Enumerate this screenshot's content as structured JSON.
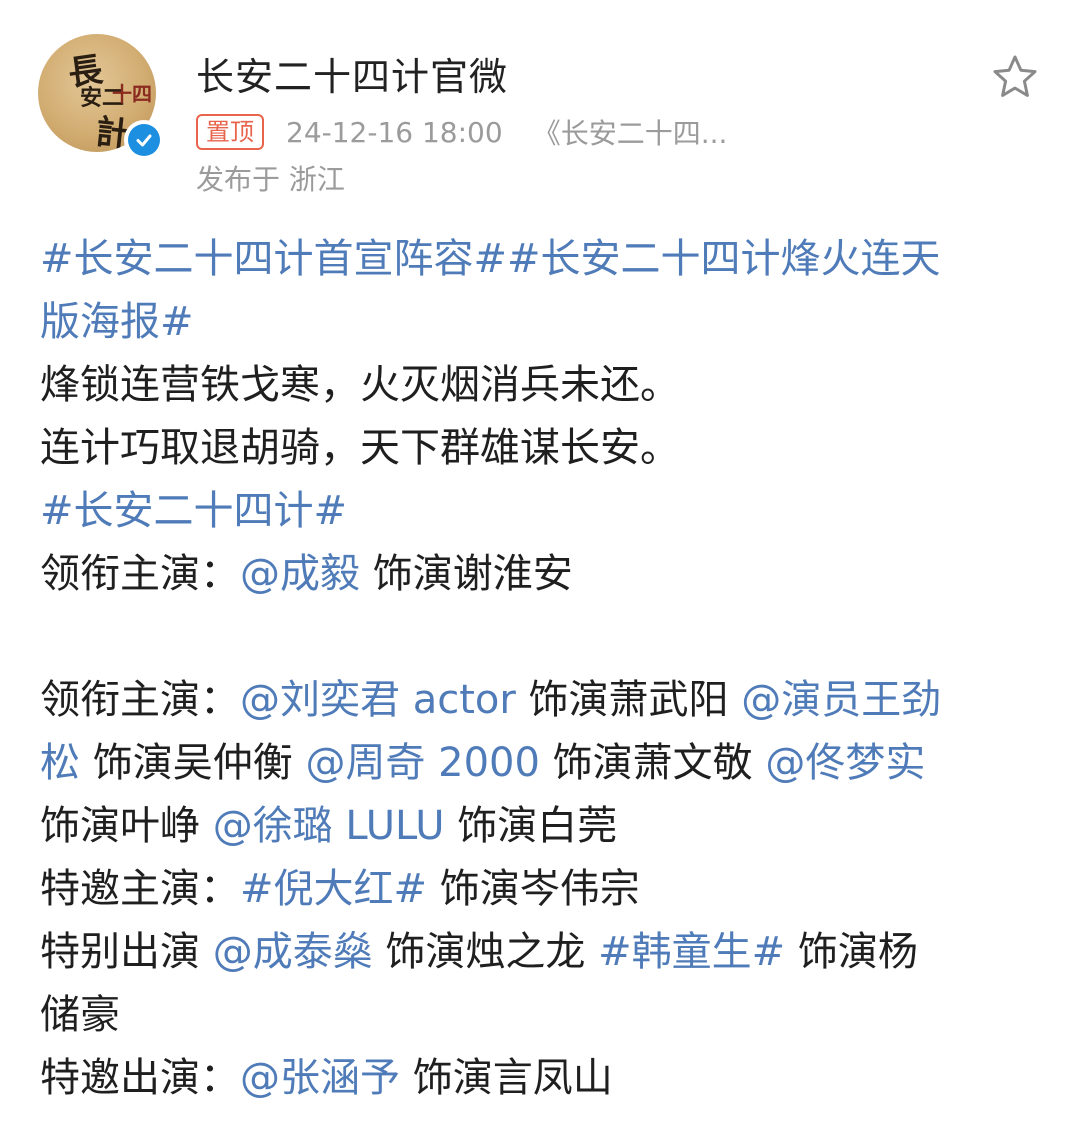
{
  "header": {
    "account_name": "长安二十四计官微",
    "avatar_glyphs": [
      "長",
      "安二",
      "十四",
      "計"
    ],
    "pinned_label": "置顶",
    "timestamp": "24-12-16 18:00",
    "source": "《长安二十四...",
    "location": "发布于 浙江",
    "icons": {
      "verified": "verified-check-icon",
      "favorite": "star-outline-icon"
    },
    "colors": {
      "pinned": "#e8654c",
      "verified": "#1d8fe0",
      "meta": "#9b9b9b"
    }
  },
  "body": {
    "link_color": "#4f7bb8",
    "l1": {
      "tag1": "#长安二十四计首宣阵容#",
      "tag2": "#长安二十四计烽火连天"
    },
    "l2": {
      "tag_cont": "版海报#"
    },
    "l3": {
      "text": "烽锁连营铁戈寒，火灭烟消兵未还。"
    },
    "l4": {
      "text": "连计巧取退胡骑，天下群雄谋长安。"
    },
    "l5": {
      "tag": "#长安二十四计#"
    },
    "l6": {
      "label": "领衔主演：",
      "m1": "@成毅",
      "t1": " 饰演谢淮安"
    },
    "l8": {
      "label": "领衔主演：",
      "m1": "@刘奕君 actor",
      "t1": " 饰演萧武阳 ",
      "m2": "@演员王劲"
    },
    "l9": {
      "m2_cont": "松",
      "t1": " 饰演吴仲衡 ",
      "m3": "@周奇 2000",
      "t2": " 饰演萧文敬 ",
      "m4": "@佟梦实"
    },
    "l10": {
      "t1": "饰演叶峥 ",
      "m5": "@徐璐 LULU",
      "t2": " 饰演白莞"
    },
    "l11": {
      "label": "特邀主演：",
      "tag": "#倪大红#",
      "t1": " 饰演岑伟宗"
    },
    "l12": {
      "label": "特别出演 ",
      "m1": "@成泰燊",
      "t1": " 饰演烛之龙 ",
      "tag": "#韩童生#",
      "t2": " 饰演杨"
    },
    "l13": {
      "t1": "储豪"
    },
    "l14": {
      "label": "特邀出演：",
      "m1": "@张涵予",
      "t1": " 饰演言凤山"
    }
  }
}
